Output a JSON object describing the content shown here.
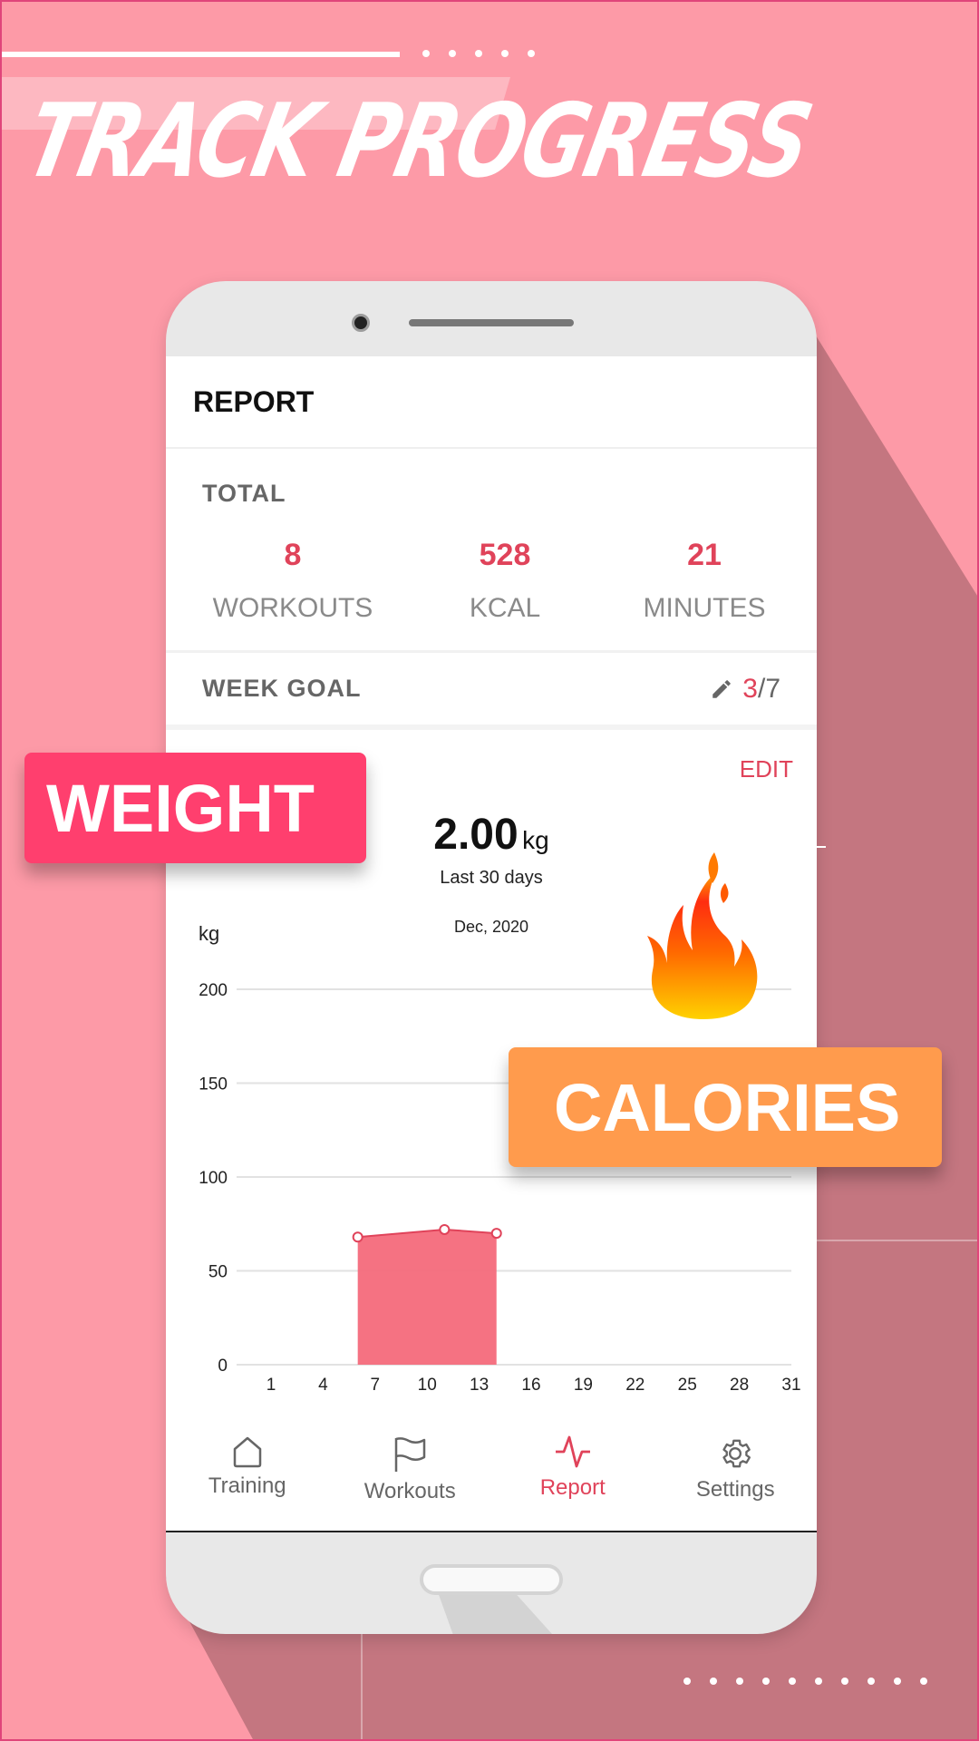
{
  "promo": {
    "headline": "TRACK PROGRESS",
    "badge_weight": "WEIGHT",
    "badge_calories": "CALORIES",
    "flame_icon": "flame-icon",
    "colors": {
      "background": "#fd9aa7",
      "weight_badge": "#ff3f6e",
      "calories_badge": "#ff9b4d",
      "accent": "#e0435a"
    }
  },
  "app": {
    "title": "REPORT",
    "total": {
      "label": "TOTAL",
      "stats": [
        {
          "value": "8",
          "label": "WORKOUTS"
        },
        {
          "value": "528",
          "label": "KCAL"
        },
        {
          "value": "21",
          "label": "MINUTES"
        }
      ]
    },
    "week_goal": {
      "label": "WEEK GOAL",
      "edit_icon": "pencil-icon",
      "done": "3",
      "separator": "/",
      "total": "7"
    },
    "weight": {
      "edit_label": "EDIT",
      "value": "2.00",
      "unit": "kg",
      "period": "Last 30 days"
    },
    "nav": [
      {
        "label": "Training",
        "icon": "home-icon",
        "active": false
      },
      {
        "label": "Workouts",
        "icon": "flag-icon",
        "active": false
      },
      {
        "label": "Report",
        "icon": "pulse-icon",
        "active": true
      },
      {
        "label": "Settings",
        "icon": "gear-icon",
        "active": false
      }
    ]
  },
  "chart_data": {
    "type": "area",
    "title": "Dec, 2020",
    "xlabel": "",
    "ylabel": "kg",
    "xlim": [
      1,
      31
    ],
    "ylim": [
      0,
      200
    ],
    "x_ticks": [
      1,
      4,
      7,
      10,
      13,
      16,
      19,
      22,
      25,
      28,
      31
    ],
    "y_ticks": [
      0,
      50,
      100,
      150,
      200
    ],
    "grid": true,
    "series": [
      {
        "name": "weight",
        "x": [
          6,
          11,
          14
        ],
        "values": [
          68,
          72,
          70
        ]
      }
    ]
  }
}
